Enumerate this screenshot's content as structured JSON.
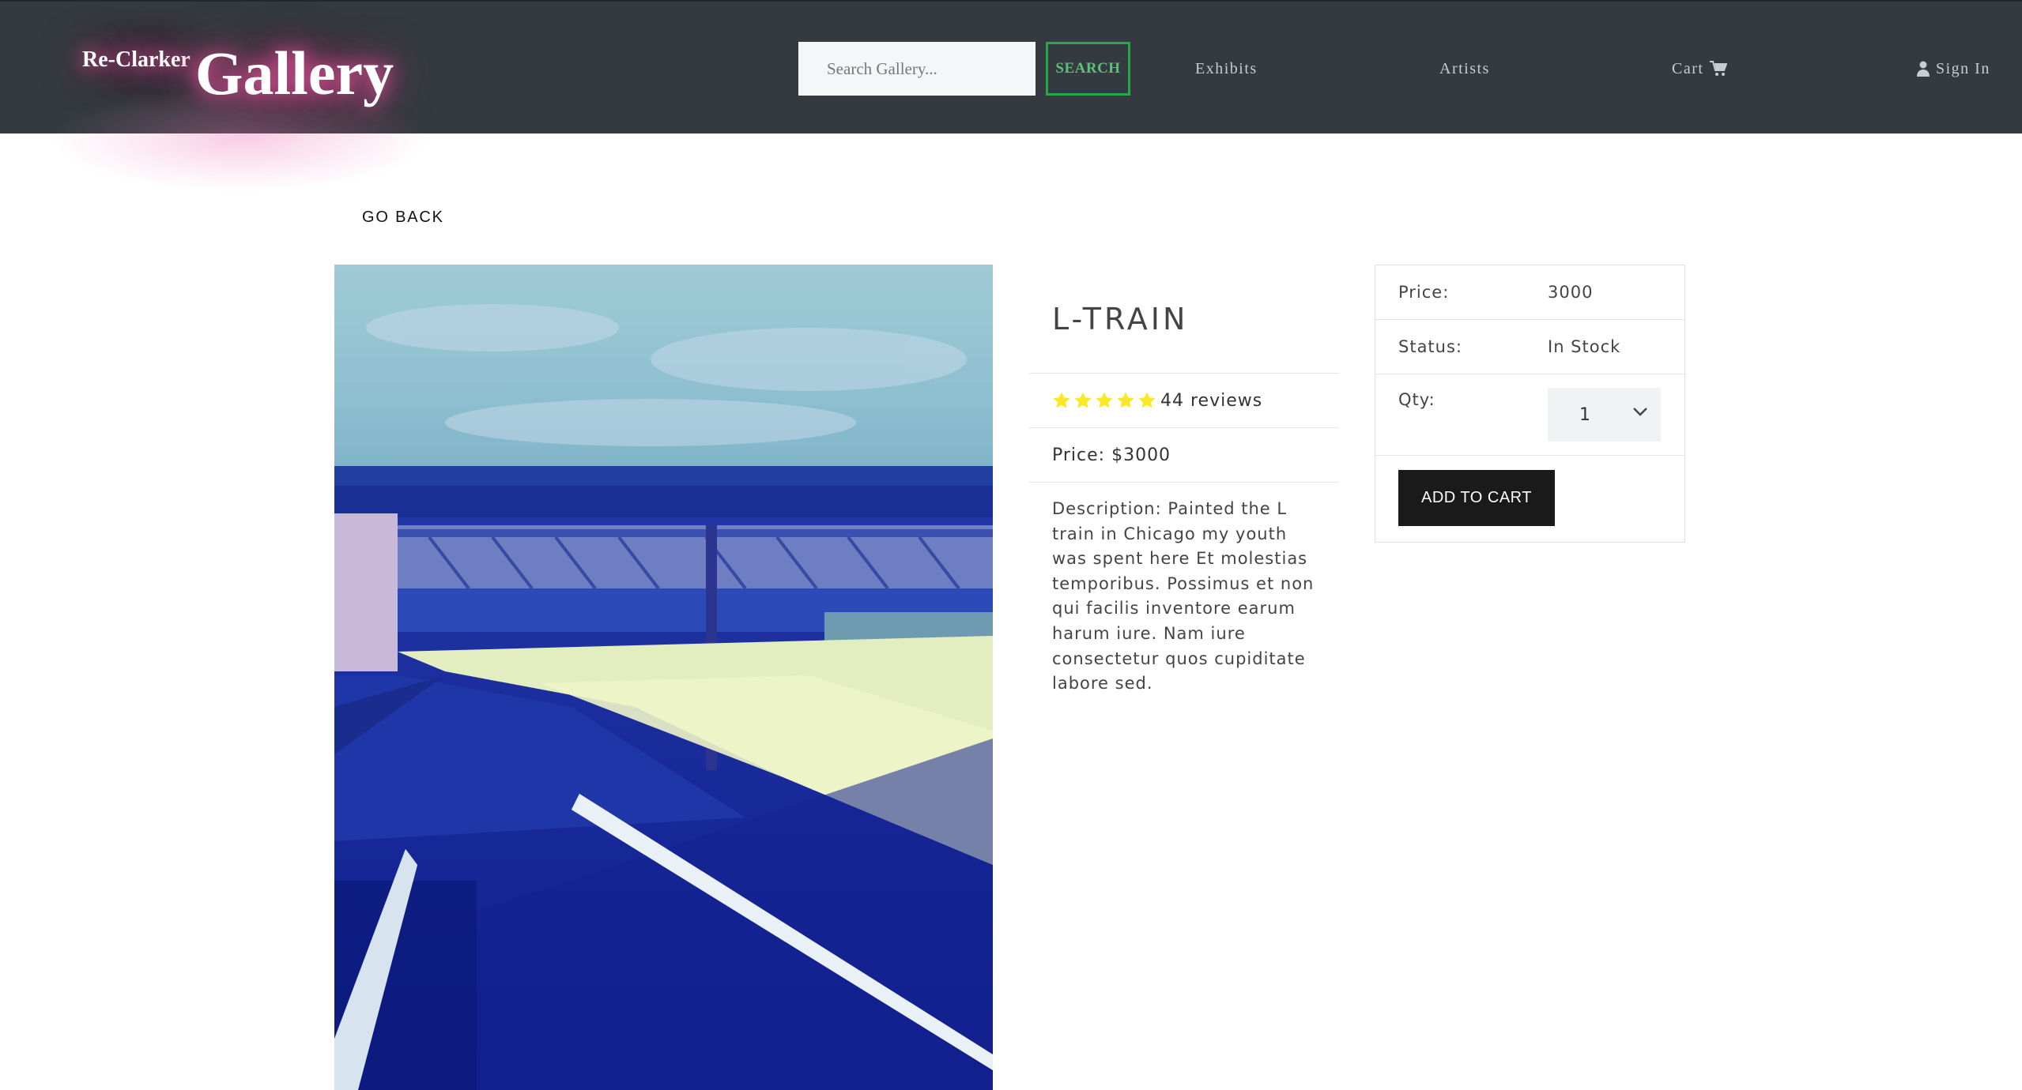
{
  "header": {
    "brand_small": "Re-Clarker",
    "brand_big": "Gallery",
    "search_placeholder": "Search Gallery...",
    "search_button": "SEARCH",
    "nav": {
      "exhibits": "Exhibits",
      "artists": "Artists",
      "cart": "Cart",
      "sign_in": "Sign In"
    },
    "icons": {
      "cart": "shopping-cart-icon",
      "sign_in": "user-icon"
    },
    "colors": {
      "background": "#343a40",
      "search_accent": "#28a745",
      "brand_glow": "#e0559a"
    }
  },
  "main": {
    "go_back": "GO BACK",
    "product": {
      "title": "L-TRAIN",
      "rating": 5,
      "reviews_text": "44 reviews",
      "price_text": "Price: $3000",
      "description": "Description: Painted the L train in Chicago my youth was spent here Et molestias temporibus. Possimus et non qui facilis inventore earum harum iure. Nam iure consectetur quos cupiditate labore sed.",
      "star_color": "#f8e825"
    },
    "cart_card": {
      "price_label": "Price:",
      "price_value": "3000",
      "status_label": "Status:",
      "status_value": "In Stock",
      "qty_label": "Qty:",
      "qty_value": "1",
      "add_to_cart": "ADD TO CART"
    }
  }
}
